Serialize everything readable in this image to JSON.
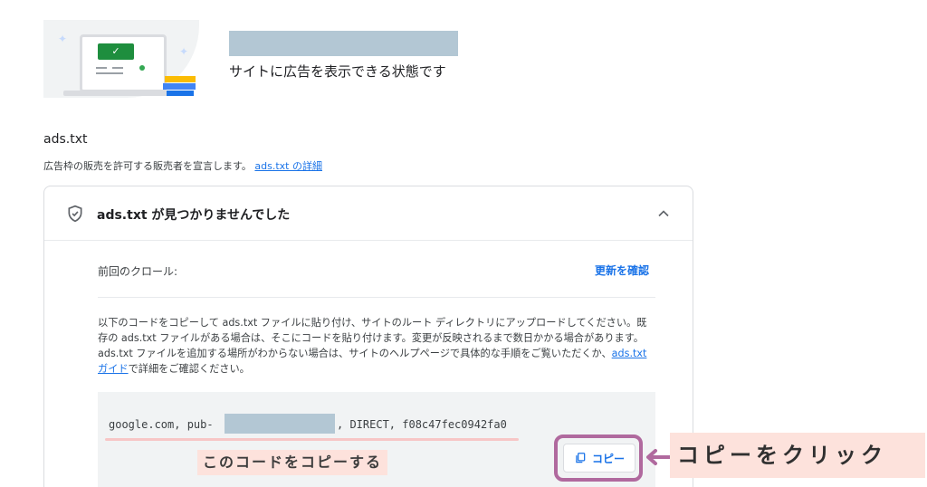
{
  "header": {
    "status_text": "サイトに広告を表示できる状態です"
  },
  "section": {
    "title": "ads.txt",
    "description": "広告枠の販売を許可する販売者を宣言します。",
    "learn_more_link": "ads.txt の詳細"
  },
  "panel": {
    "title": "ads.txt が見つかりませんでした",
    "crawl_label": "前回のクロール:",
    "refresh_link": "更新を確認",
    "instructions_before": "以下のコードをコピーして ads.txt ファイルに貼り付け、サイトのルート ディレクトリにアップロードしてください。既存の ads.txt ファイルがある場合は、そこにコードを貼り付けます。変更が反映されるまで数日かかる場合があります。ads.txt ファイルを追加する場所がわからない場合は、サイトのヘルプページで具体的な手順をご覧いただくか、",
    "guide_link": "ads.txt ガイド",
    "instructions_after": "で詳細をご確認ください。",
    "code_prefix": "google.com, pub-",
    "code_suffix": ", DIRECT, f08c47fec0942fa0",
    "copy_button": "コピー"
  },
  "annotations": {
    "code_note": "このコードをコピーする",
    "click_note": "コピーをクリック"
  },
  "icons": {
    "shield": "shield-check-icon",
    "chevron": "chevron-up-icon",
    "copy": "copy-icon",
    "arrow": "arrow-left-icon"
  },
  "colors": {
    "link": "#1a73e8",
    "highlight_border": "#b0699e",
    "annotation_bg": "#fde2dc",
    "redaction": "#b3c7d4"
  }
}
